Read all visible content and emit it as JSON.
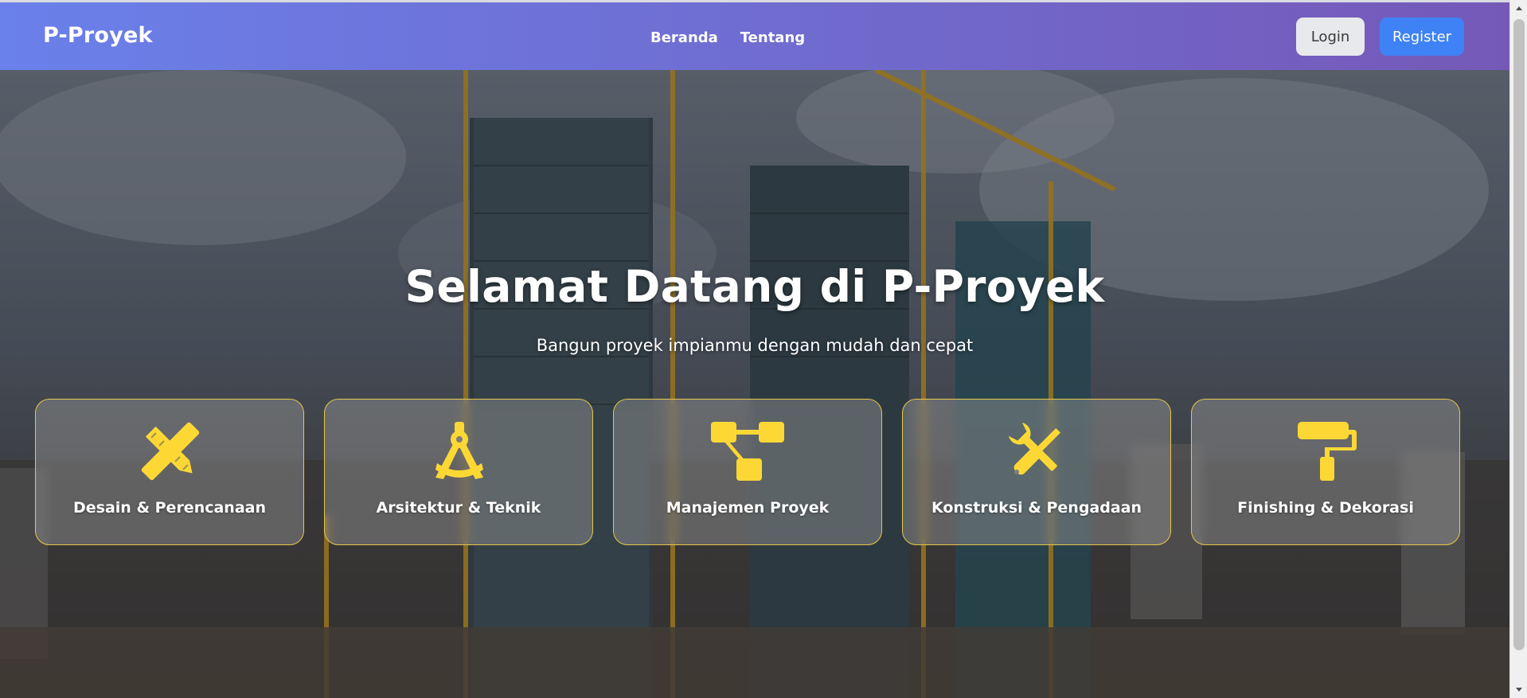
{
  "navbar": {
    "brand": "P-Proyek",
    "links": [
      "Beranda",
      "Tentang"
    ],
    "login_label": "Login",
    "register_label": "Register",
    "gradient_start": "#6a80ea",
    "gradient_end": "#7559b8"
  },
  "hero": {
    "title": "Selamat Datang di P-Proyek",
    "subtitle": "Bangun proyek impianmu dengan mudah dan cepat"
  },
  "services": [
    {
      "label": "Desain & Perencanaan",
      "icon": "pencil-ruler-icon"
    },
    {
      "label": "Arsitektur & Teknik",
      "icon": "compass-drafting-icon"
    },
    {
      "label": "Manajemen Proyek",
      "icon": "sitemap-icon"
    },
    {
      "label": "Konstruksi & Pengadaan",
      "icon": "screwdriver-wrench-icon"
    },
    {
      "label": "Finishing & Dekorasi",
      "icon": "paint-roller-icon"
    }
  ],
  "colors": {
    "accent": "#fdd835",
    "card_border": "#e5c84a",
    "register_button": "#3f82f5"
  }
}
